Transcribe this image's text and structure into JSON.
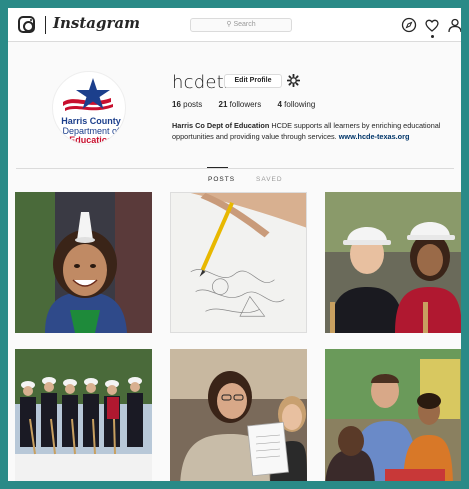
{
  "app": {
    "wordmark": "Instagram",
    "search_placeholder": "Search",
    "nav_icons": [
      "compass-icon",
      "heart-icon",
      "person-icon"
    ]
  },
  "profile": {
    "username": "hcdetx",
    "edit_label": "Edit Profile",
    "avatar_text": [
      "Harris County",
      "Department of",
      "Education"
    ],
    "stats": {
      "posts_count": "16",
      "posts_label": "posts",
      "followers_count": "21",
      "followers_label": "followers",
      "following_count": "4",
      "following_label": "following"
    },
    "bio": {
      "name": "Harris Co Dept of Education",
      "text": "HCDE supports all learners by enriching educational opportunities and providing value through services.",
      "link": "www.hcde-texas.org"
    }
  },
  "tabs": [
    {
      "label": "POSTS",
      "active": true
    },
    {
      "label": "SAVED",
      "active": false
    }
  ],
  "colors": {
    "background_frame": "#2a8a87",
    "text": "#262626",
    "muted": "#999999",
    "link": "#003569",
    "brand_blue": "#1c3f8c",
    "brand_red": "#c8102e"
  },
  "posts": [
    {
      "depicts": "girl-smiling"
    },
    {
      "depicts": "hand-drawing"
    },
    {
      "depicts": "women-hardhats"
    },
    {
      "depicts": "groundbreaking"
    },
    {
      "depicts": "woman-showing-booklet"
    },
    {
      "depicts": "classroom-group"
    }
  ]
}
